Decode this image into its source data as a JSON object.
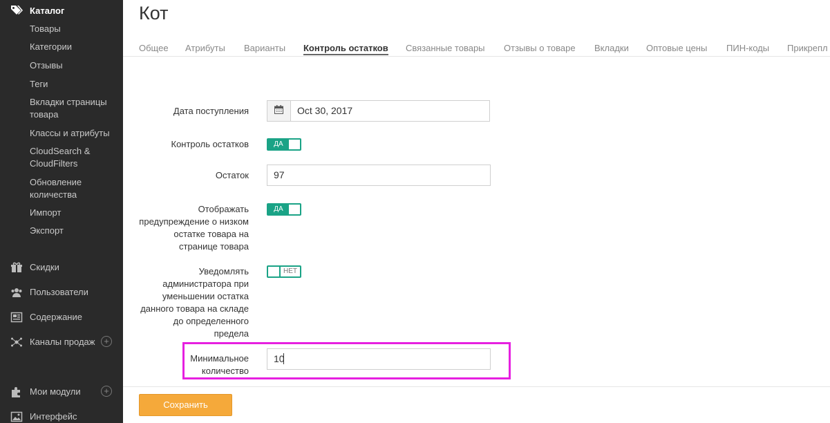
{
  "sidebar": {
    "catalog": {
      "label": "Каталог",
      "icon": "tags-icon",
      "items": [
        "Товары",
        "Категории",
        "Отзывы",
        "Теги",
        "Вкладки страницы товара",
        "Классы и атрибуты",
        "CloudSearch & CloudFilters",
        "Обновление количества",
        "Импорт",
        "Экспорт"
      ]
    },
    "main": [
      {
        "label": "Скидки",
        "icon": "gift-icon"
      },
      {
        "label": "Пользователи",
        "icon": "users-icon"
      },
      {
        "label": "Содержание",
        "icon": "newspaper-icon"
      },
      {
        "label": "Каналы продаж",
        "icon": "network-icon",
        "plus": "+"
      },
      {
        "label": "Мои модули",
        "icon": "puzzle-icon",
        "plus": "+"
      },
      {
        "label": "Интерфейс",
        "icon": "image-icon"
      }
    ]
  },
  "page": {
    "title": "Кот"
  },
  "tabs": [
    "Общее",
    "Атрибуты",
    "Варианты",
    "Контроль остатков",
    "Связанные товары",
    "Отзывы о товаре",
    "Вкладки",
    "Оптовые цены",
    "ПИН-коды",
    "Прикрепл"
  ],
  "active_tab": "Контроль остатков",
  "form": {
    "arrival_date": {
      "label": "Дата поступления",
      "value": "Oct 30, 2017"
    },
    "stock_control": {
      "label": "Контроль остатков",
      "state": "ДА"
    },
    "stock": {
      "label": "Остаток",
      "value": "97"
    },
    "low_stock_warning": {
      "label": "Отображать предупреждение о низком остатке товара на странице товара",
      "state": "ДА"
    },
    "notify_admin": {
      "label": "Уведомлять администратора при уменьшении остатка данного товара на складе до определенного предела",
      "state": "НЕТ"
    },
    "min_quantity": {
      "label": "Минимальное количество",
      "value": "10"
    }
  },
  "footer": {
    "save_label": "Сохранить"
  },
  "colors": {
    "sidebar_bg": "#2a2a2a",
    "toggle": "#1aa386",
    "save_button": "#f5a93a",
    "highlight": "#e620e0"
  }
}
